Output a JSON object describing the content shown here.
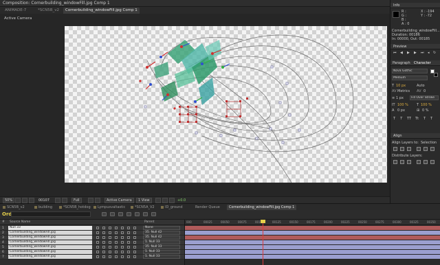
{
  "composition": {
    "title": "Composition: Cornerbuilding_windowFill.jpg Comp 1",
    "tabs": [
      "ANIMADE-7",
      "*SCN5B_v2",
      "Cornerbuilding_windowFill.jpg Comp 1"
    ],
    "active_tab": 2,
    "view_label": "Active Camera",
    "footer": {
      "zoom": "50%",
      "timecode": "00107",
      "resolution": "Full",
      "camera": "Active Camera",
      "views": "1 View",
      "exposure": "+0.0"
    }
  },
  "info_panel": {
    "title": "Info",
    "r": "R :",
    "g": "G :",
    "b": "B :",
    "a": "A : 0",
    "x": "X : -194",
    "y": "Y : -72",
    "item_name": "Cornerbuilding_windowFill...",
    "duration": "Duration: 00186",
    "in_out": "In: 00000, Out: 00185"
  },
  "preview_panel": {
    "title": "Preview"
  },
  "character_panel": {
    "tabs": [
      "Paragraph",
      "Character"
    ],
    "font": "Nova Gothic",
    "style": "Medium",
    "size": "10 px",
    "leading": "Auto",
    "kerning": "Metrics",
    "tracking": "0",
    "stroke": "1 px",
    "stroke_type": "Fill Over Stroke",
    "vscale": "100 %",
    "hscale": "100 %",
    "baseline": "0 px",
    "tsume": "0 %",
    "styles": [
      "T",
      "T",
      "TT",
      "Tt",
      "T",
      "T"
    ]
  },
  "align_panel": {
    "title": "Align",
    "align_to_label": "Align Layers to:",
    "align_to_value": "Selection",
    "distribute_label": "Distribute Layers:"
  },
  "bottom_tabs": [
    "SCN5B_v2",
    "building",
    "*SCN5B_hotdog",
    "Lympusvaltastic",
    "*SCN5A_V2",
    "ID_ground",
    "Render Queue",
    "Cornerbuilding_windowFill.jpg Comp 1"
  ],
  "timeline": {
    "current_time": "Ord",
    "column_source": "Source Name",
    "column_parent": "Parent",
    "ruler_ticks": [
      "000",
      "00025",
      "00050",
      "00075",
      "00100",
      "00125",
      "00150",
      "00175",
      "00200",
      "00225",
      "00250",
      "00275",
      "00300",
      "00325",
      "00350"
    ],
    "layers": [
      {
        "num": "1",
        "name": "Null 33",
        "parent": "None"
      },
      {
        "num": "2",
        "name": "Cornerbuilding_windowFill.jpg",
        "parent": "35. Null 42"
      },
      {
        "num": "3",
        "name": "Cornerbuilding_windowFill.jpg",
        "parent": "35. Null 42"
      },
      {
        "num": "4",
        "name": "Cornerbuilding_windowFill.jpg",
        "parent": "1. Null 33"
      },
      {
        "num": "5",
        "name": "Cornerbuilding_windowFill.jpg",
        "parent": "35. Null 33"
      },
      {
        "num": "6",
        "name": "Cornerbuilding_windowFill.jpg",
        "parent": "1. Null 33"
      },
      {
        "num": "7",
        "name": "Cornerbuilding_windowFill.jpg",
        "parent": "1. Null 33"
      }
    ],
    "bar_colors": [
      "#b05b5b",
      "#9b9fcf",
      "#b05b5b",
      "#9b9fcf",
      "#9b9fcf",
      "#9b9fcf",
      "#9b9fcf"
    ]
  },
  "colors": {
    "accent_time": "#e6d14b",
    "playhead": "#e03a3a"
  }
}
